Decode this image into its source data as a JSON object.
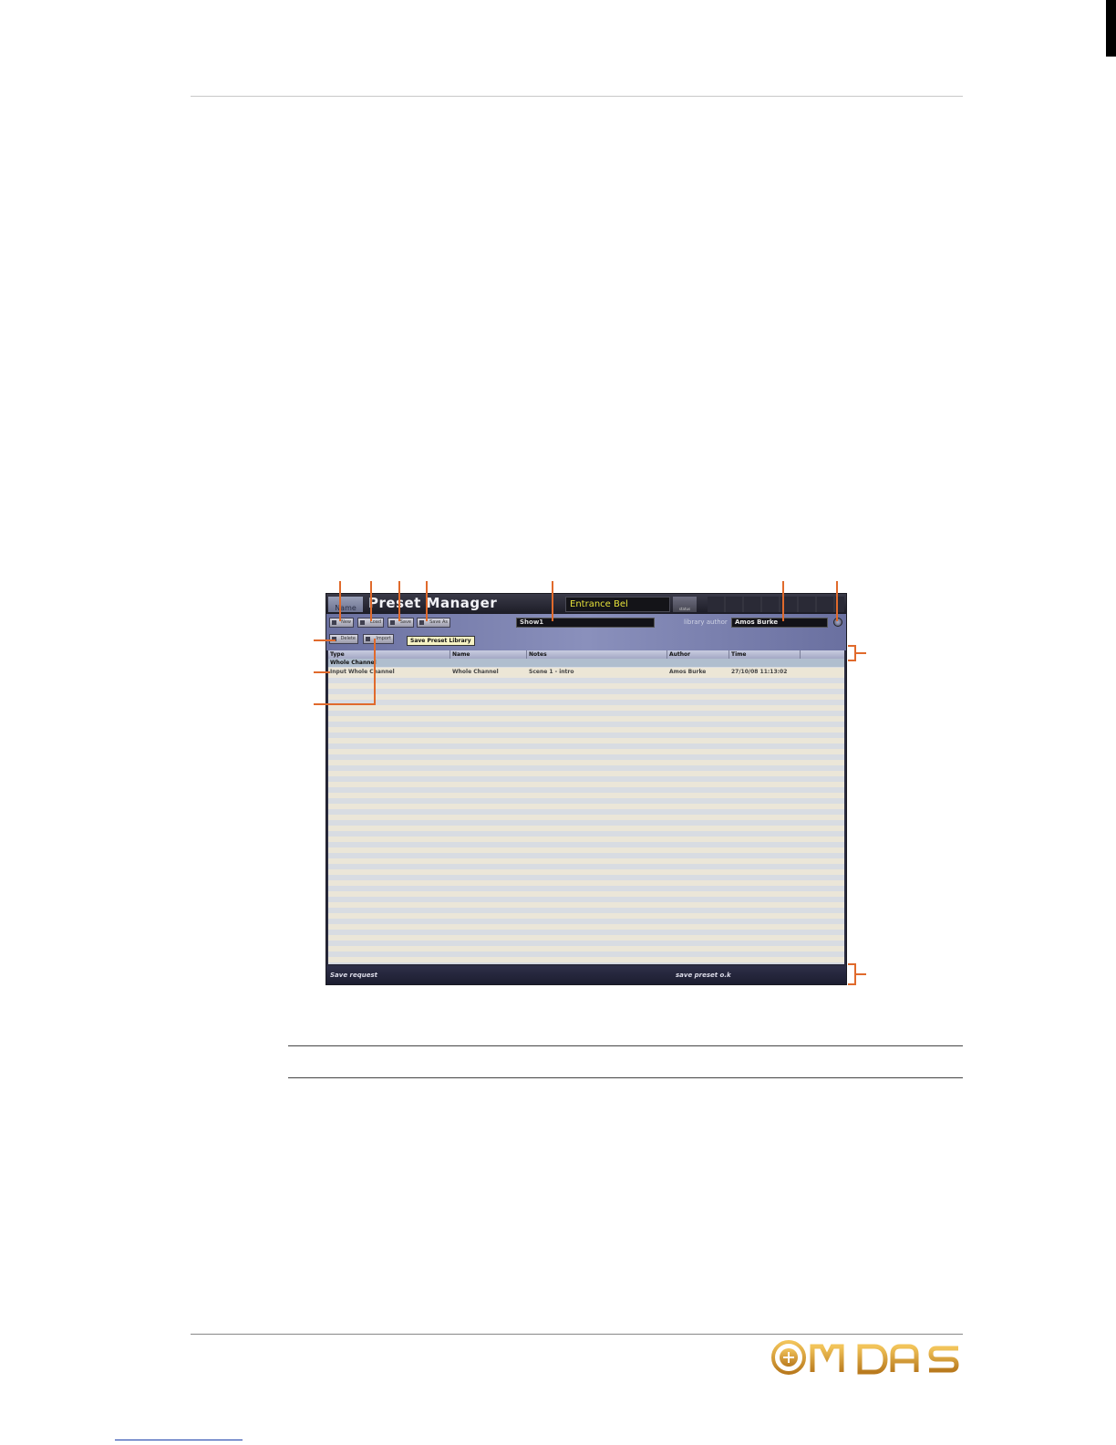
{
  "screenshot": {
    "tab_name": "Name",
    "app_title": "Preset Manager",
    "scene_name": "Entrance Bel",
    "status_button": "status",
    "toolbar": {
      "buttons": [
        "New",
        "Load",
        "Save",
        "Save As"
      ],
      "tooltip": "Save Preset Library",
      "library_name": "Show1",
      "author_label": "library author",
      "author_value": "Amos Burke",
      "second_row_buttons": [
        "Delete",
        "Import"
      ]
    },
    "table": {
      "columns": [
        "Type",
        "Name",
        "Notes",
        "Author",
        "Time"
      ],
      "group": "Whole Channel",
      "rows": [
        {
          "type": "Input Whole Channel",
          "name": "Whole Channel",
          "notes": "Scene 1 - intro",
          "author": "Amos Burke",
          "time": "27/10/08 11:13:02"
        }
      ]
    },
    "status_left": "Save request",
    "status_right": "save preset o.k"
  },
  "brand": {
    "logo_name": "MIDAS",
    "accent_color": "#e06a2c",
    "logo_color": "#d9a23a"
  }
}
